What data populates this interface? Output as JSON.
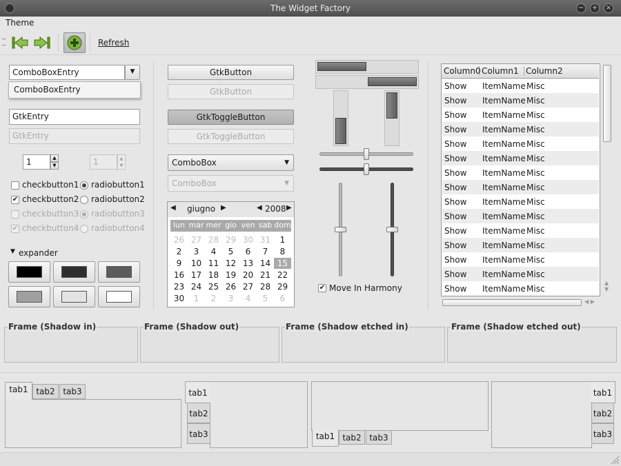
{
  "window": {
    "title": "The Widget Factory",
    "min_glyph": "−",
    "max_glyph": "+",
    "close_glyph": "×"
  },
  "menubar": {
    "theme": "Theme"
  },
  "toolbar": {
    "refresh": "Refresh"
  },
  "left": {
    "combo_entry": {
      "value": "ComboBoxEntry",
      "dropdown_item": "ComboBoxEntry"
    },
    "entry": {
      "value": "GtkEntry",
      "disabled_value": "GtkEntry"
    },
    "spin": {
      "value": "1",
      "disabled_value": "1"
    },
    "checks": [
      {
        "label": "checkbutton1",
        "checked": false,
        "disabled": false
      },
      {
        "label": "checkbutton2",
        "checked": true,
        "disabled": false
      },
      {
        "label": "checkbutton3",
        "checked": false,
        "disabled": true
      },
      {
        "label": "checkbutton4",
        "checked": true,
        "disabled": true
      }
    ],
    "radios": [
      {
        "label": "radiobutton1",
        "selected": true,
        "disabled": false
      },
      {
        "label": "radiobutton2",
        "selected": false,
        "disabled": false
      },
      {
        "label": "radiobutton3",
        "selected": true,
        "disabled": true
      },
      {
        "label": "radiobutton4",
        "selected": false,
        "disabled": true
      }
    ],
    "expander": "expander",
    "swatches": [
      "#000000",
      "#2f2f2f",
      "#5c5c5c",
      "#a0a0a0",
      "#e4e4e4",
      "#ffffff"
    ]
  },
  "mid": {
    "button": "GtkButton",
    "button_disabled": "GtkButton",
    "toggle": "GtkToggleButton",
    "toggle_disabled": "GtkToggleButton",
    "combo": "ComboBox",
    "combo_disabled": "ComboBox",
    "calendar": {
      "month": "giugno",
      "year": "2008",
      "weekdays": [
        "lun",
        "mar",
        "mer",
        "gio",
        "ven",
        "sab",
        "dom"
      ],
      "weeks": [
        [
          "26",
          "27",
          "28",
          "29",
          "30",
          "31",
          "1"
        ],
        [
          "2",
          "3",
          "4",
          "5",
          "6",
          "7",
          "8"
        ],
        [
          "9",
          "10",
          "11",
          "12",
          "13",
          "14",
          "15"
        ],
        [
          "16",
          "17",
          "18",
          "19",
          "20",
          "21",
          "22"
        ],
        [
          "23",
          "24",
          "25",
          "26",
          "27",
          "28",
          "29"
        ],
        [
          "30",
          "1",
          "2",
          "3",
          "4",
          "5",
          "6"
        ]
      ],
      "selected": "15"
    }
  },
  "sliders": {
    "hprogress1": 0.5,
    "hprogress2": 0.5,
    "vprogress1": 0.5,
    "vprogress2": 0.5,
    "hscale1": 0.5,
    "hscale2": 0.5,
    "vscale1": 0.5,
    "vscale2": 0.5,
    "move_in_harmony": "Move In Harmony"
  },
  "tree": {
    "columns": [
      "Column0",
      "Column1",
      "Column2"
    ],
    "rows": [
      [
        "Show",
        "ItemName",
        "Misc"
      ],
      [
        "Show",
        "ItemName",
        "Misc"
      ],
      [
        "Show",
        "ItemName",
        "Misc"
      ],
      [
        "Show",
        "ItemName",
        "Misc"
      ],
      [
        "Show",
        "ItemName",
        "Misc"
      ],
      [
        "Show",
        "ItemName",
        "Misc"
      ],
      [
        "Show",
        "ItemName",
        "Misc"
      ],
      [
        "Show",
        "ItemName",
        "Misc"
      ],
      [
        "Show",
        "ItemName",
        "Misc"
      ],
      [
        "Show",
        "ItemName",
        "Misc"
      ],
      [
        "Show",
        "ItemName",
        "Misc"
      ],
      [
        "Show",
        "ItemName",
        "Misc"
      ],
      [
        "Show",
        "ItemName",
        "Misc"
      ],
      [
        "Show",
        "ItemName",
        "Misc"
      ],
      [
        "Show",
        "ItemName",
        "Misc"
      ]
    ]
  },
  "frames": [
    "Frame (Shadow in)",
    "Frame (Shadow out)",
    "Frame (Shadow etched in)",
    "Frame (Shadow etched out)"
  ],
  "tabs": {
    "top": [
      "tab1",
      "tab2",
      "tab3"
    ],
    "left": [
      "tab1",
      "tab2",
      "tab3"
    ],
    "bottom": [
      "tab1",
      "tab2",
      "tab3"
    ],
    "right": [
      "tab1",
      "tab2",
      "tab3"
    ]
  }
}
